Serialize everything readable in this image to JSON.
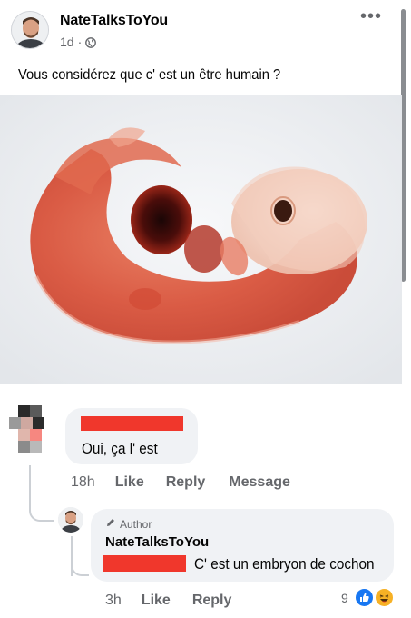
{
  "post": {
    "author": "NateTalksToYou",
    "timestamp": "1d",
    "separator": "·",
    "privacy_icon": "globe-icon",
    "more_icon": "more-horizontal-icon",
    "more_glyph": "•••",
    "text": "Vous considérez que c' est un être humain ?",
    "image_icon": "embryo-photo"
  },
  "comment": {
    "text": "Oui, ça l' est",
    "time": "18h",
    "like_label": "Like",
    "reply_label": "Reply",
    "message_label": "Message"
  },
  "reply": {
    "badge_label": "Author",
    "badge_icon": "pencil-icon",
    "author": "NateTalksToYou",
    "text": "C' est un embryon de cochon",
    "time": "3h",
    "like_label": "Like",
    "reply_label": "Reply",
    "reaction_count": "9",
    "reaction_icons": [
      "like-reaction-icon",
      "haha-reaction-icon"
    ]
  },
  "colors": {
    "redaction": "#f0372c",
    "facebook_blue": "#1877f2",
    "bubble": "#f0f2f5",
    "meta_text": "#65676b"
  }
}
